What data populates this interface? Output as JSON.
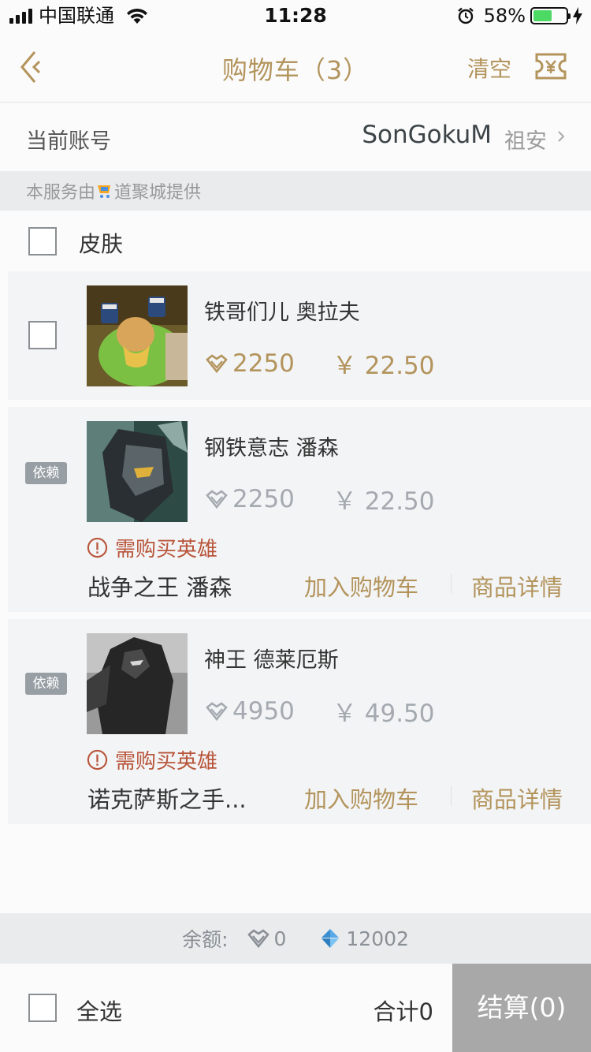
{
  "status_bar": {
    "carrier": "中国联通",
    "time": "11:28",
    "battery": "58%"
  },
  "nav": {
    "title": "购物车（3）",
    "clear_label": "清空"
  },
  "account": {
    "label": "当前账号",
    "name": "SonGokuM",
    "server": "祖安"
  },
  "service_notice": {
    "prefix": "本服务由",
    "suffix": "道聚城提供"
  },
  "category": {
    "label": "皮肤"
  },
  "items": [
    {
      "name": "铁哥们儿 奥拉夫",
      "coupon_price": "2250",
      "rmb_price": "￥ 22.50"
    },
    {
      "badge": "依赖",
      "name": "钢铁意志 潘森",
      "coupon_price": "2250",
      "rmb_price": "￥ 22.50",
      "warning": "需购买英雄",
      "required_hero": "战争之王 潘森",
      "add_cart_label": "加入购物车",
      "detail_label": "商品详情"
    },
    {
      "badge": "依赖",
      "name": "神王 德莱厄斯",
      "coupon_price": "4950",
      "rmb_price": "￥ 49.50",
      "warning": "需购买英雄",
      "required_hero": "诺克萨斯之手...",
      "add_cart_label": "加入购物车",
      "detail_label": "商品详情"
    }
  ],
  "balance": {
    "label": "余额:",
    "coupons": "0",
    "diamonds": "12002"
  },
  "bottom": {
    "select_all_label": "全选",
    "total_label": "合计0",
    "checkout_label": "结算(0)"
  },
  "colors": {
    "accent": "#b3945c",
    "warning": "#b8553a",
    "checkout_bg": "#a8a8a8"
  }
}
